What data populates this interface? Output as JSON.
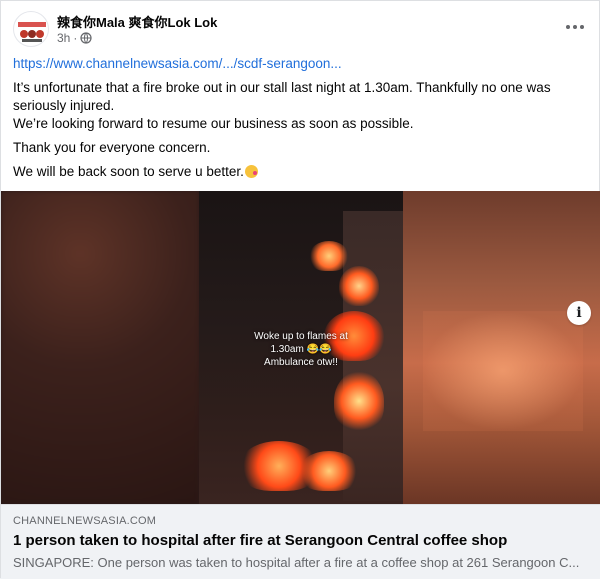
{
  "post": {
    "page_name": "辣食你Mala 爽食你Lok Lok",
    "time": "3h",
    "privacy_icon": "globe-icon",
    "link_text": "https://www.channelnewsasia.com/.../scdf-serangoon...",
    "paragraph_1_line_1": "It’s unfortunate that a fire broke out in our stall last night at 1.30am. Thankfully no one was",
    "paragraph_1_line_2": "seriously injured.",
    "paragraph_1_line_3": "We’re looking forward to resume our business as soon as possible.",
    "paragraph_2": "Thank you for everyone concern.",
    "paragraph_3": "We will be back soon to serve u better.",
    "emoji_icon": "kissing-face-emoji-icon"
  },
  "media": {
    "overlay_line_1": "Woke up to flames at",
    "overlay_line_2": "1.30am 😂😂",
    "overlay_line_3": "Ambulance otw!!",
    "info_label": "i"
  },
  "link_preview": {
    "domain": "CHANNELNEWSASIA.COM",
    "headline": "1 person taken to hospital after fire at Serangoon Central coffee shop",
    "summary": "SINGAPORE: One person was taken to hospital after a fire at a coffee shop at 261 Serangoon C..."
  },
  "colors": {
    "link": "#216fdb",
    "secondary_text": "#65676b",
    "preview_bg": "#f0f2f5"
  }
}
